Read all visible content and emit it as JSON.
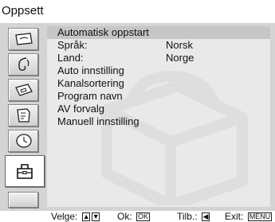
{
  "header": {
    "title": "Oppsett"
  },
  "sidebar": {
    "items": [
      {
        "icon": "picture-icon"
      },
      {
        "icon": "sound-icon"
      },
      {
        "icon": "screen-icon"
      },
      {
        "icon": "features-icon"
      },
      {
        "icon": "timer-icon"
      },
      {
        "icon": "toolbox-icon",
        "active": true
      },
      {
        "icon": "empty-slot"
      }
    ]
  },
  "menu": {
    "items": [
      {
        "label": "Automatisk oppstart",
        "value": ""
      },
      {
        "label": "Språk:",
        "value": "Norsk"
      },
      {
        "label": "Land:",
        "value": "Norge"
      },
      {
        "label": "Auto innstilling",
        "value": ""
      },
      {
        "label": "Kanalsortering",
        "value": ""
      },
      {
        "label": "Program navn",
        "value": ""
      },
      {
        "label": "AV forvalg",
        "value": ""
      },
      {
        "label": "Manuell innstilling",
        "value": ""
      }
    ]
  },
  "footer": {
    "select_label": "Velge:",
    "ok_label": "Ok:",
    "ok_key": "OK",
    "back_label": "Tilb.:",
    "exit_label": "Exit:",
    "exit_key": "MENU"
  }
}
